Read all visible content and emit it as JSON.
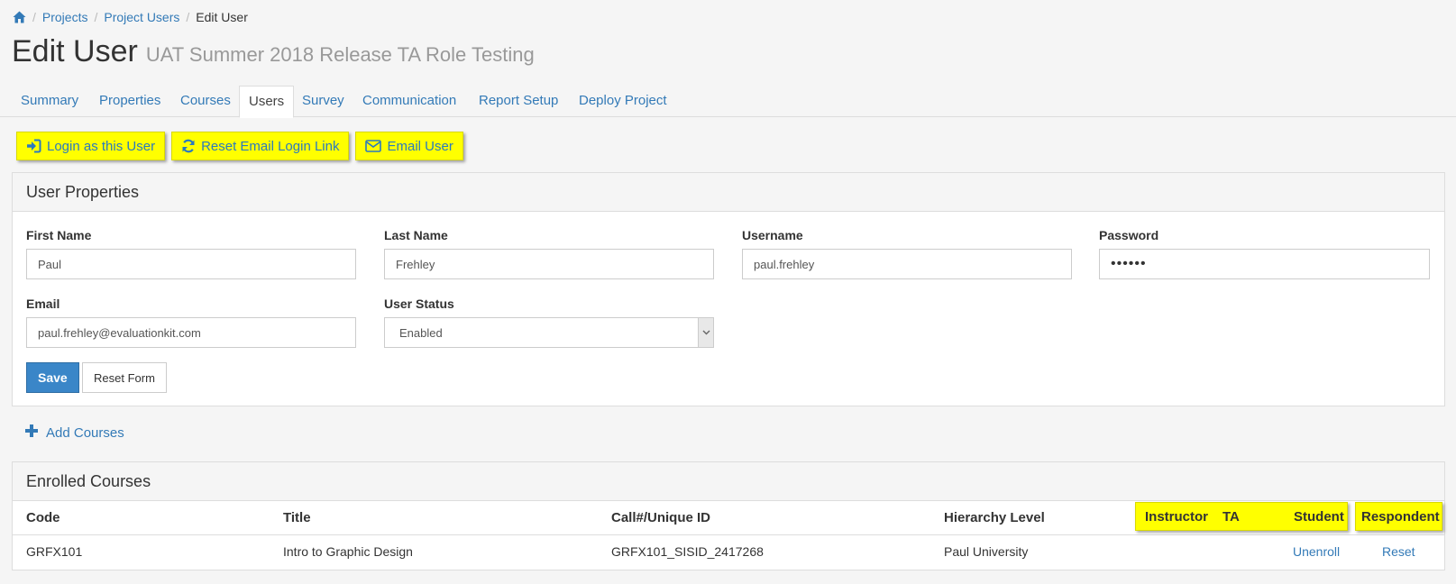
{
  "breadcrumb": {
    "home_icon": "home-icon",
    "items": [
      "Projects",
      "Project Users"
    ],
    "current": "Edit User"
  },
  "header": {
    "title": "Edit User",
    "subtitle": "UAT Summer 2018 Release TA Role Testing"
  },
  "tabs": [
    {
      "label": "Summary"
    },
    {
      "label": "Properties"
    },
    {
      "label": "Courses"
    },
    {
      "label": "Users",
      "active": true
    },
    {
      "label": "Survey"
    },
    {
      "label": "Communication"
    },
    {
      "label": "Report Setup"
    },
    {
      "label": "Deploy Project"
    }
  ],
  "actions": {
    "login_as_user": {
      "label": "Login as this User",
      "icon": "sign-in-icon"
    },
    "reset_email_link": {
      "label": "Reset Email Login Link",
      "icon": "refresh-icon"
    },
    "email_user": {
      "label": "Email User",
      "icon": "envelope-icon"
    },
    "highlight_color": "#ffff00"
  },
  "user_properties": {
    "heading": "User Properties",
    "first_name": {
      "label": "First Name",
      "value": "Paul"
    },
    "last_name": {
      "label": "Last Name",
      "value": "Frehley"
    },
    "username": {
      "label": "Username",
      "value": "paul.frehley"
    },
    "password": {
      "label": "Password",
      "value": "••••••"
    },
    "email": {
      "label": "Email",
      "value": "paul.frehley@evaluationkit.com"
    },
    "user_status": {
      "label": "User Status",
      "value": "Enabled"
    },
    "save_label": "Save",
    "reset_label": "Reset Form"
  },
  "add_courses": {
    "label": "Add Courses",
    "icon": "plus-icon"
  },
  "enrolled_courses": {
    "heading": "Enrolled Courses",
    "columns": {
      "code": "Code",
      "title": "Title",
      "call_id": "Call#/Unique ID",
      "hierarchy": "Hierarchy Level",
      "instructor": "Instructor",
      "ta": "TA",
      "student": "Student",
      "respondent": "Respondent"
    },
    "rows": [
      {
        "code": "GRFX101",
        "title": "Intro to Graphic Design",
        "call_id": "GRFX101_SISID_2417268",
        "hierarchy": "Paul University",
        "student_action": "Unenroll",
        "respondent_action": "Reset"
      }
    ]
  },
  "colors": {
    "link": "#337ab7",
    "primary_button": "#3a86c8",
    "highlight": "#ffff00"
  }
}
